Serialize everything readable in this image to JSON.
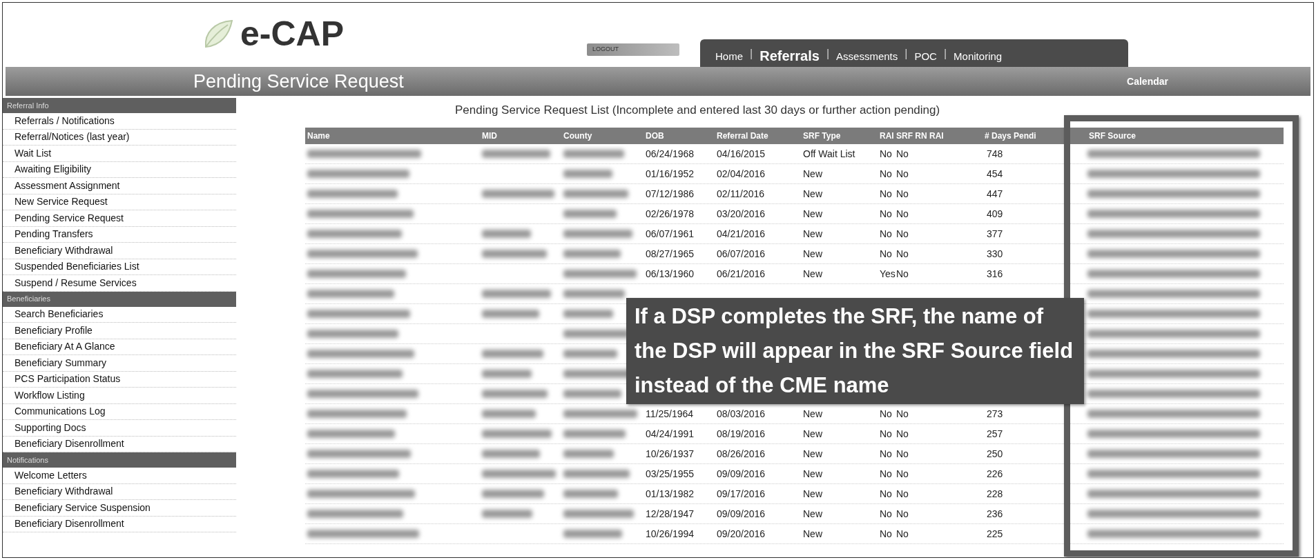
{
  "logo": {
    "text": "e-CAP"
  },
  "logout_button": "LOGOUT",
  "nav": {
    "separator": "|",
    "tabs": [
      {
        "label": "Home",
        "selected": false
      },
      {
        "label": "Referrals",
        "selected": true
      },
      {
        "label": "Assessments",
        "selected": false
      },
      {
        "label": "POC",
        "selected": false
      },
      {
        "label": "Monitoring",
        "selected": false
      }
    ]
  },
  "page_title": "Pending Service Request",
  "calendar_link": "Calendar",
  "sidebar": [
    {
      "heading": "Referral Info",
      "items": [
        "Referrals / Notifications",
        "Referral/Notices (last year)",
        "Wait List",
        "Awaiting Eligibility",
        "Assessment Assignment",
        "New Service Request",
        "Pending Service Request",
        "Pending Transfers",
        "Beneficiary Withdrawal",
        "Suspended Beneficiaries List",
        "Suspend / Resume Services"
      ]
    },
    {
      "heading": "Beneficiaries",
      "items": [
        "Search Beneficiaries",
        "Beneficiary Profile",
        "Beneficiary At A Glance",
        "Beneficiary Summary",
        "PCS Participation Status",
        "Workflow Listing",
        "Communications Log",
        "Supporting Docs",
        "Beneficiary Disenrollment"
      ]
    },
    {
      "heading": "Notifications",
      "items": [
        "Welcome Letters",
        "Beneficiary Withdrawal",
        "Beneficiary Service Suspension",
        "Beneficiary Disenrollment"
      ]
    }
  ],
  "list_title": "Pending Service Request List (Incomplete and entered last 30 days or further action pending)",
  "table": {
    "columns": [
      {
        "label": "Name",
        "highlighted": false
      },
      {
        "label": "MID",
        "highlighted": false
      },
      {
        "label": "County",
        "highlighted": false
      },
      {
        "label": "DOB",
        "highlighted": false
      },
      {
        "label": "Referral Date",
        "highlighted": false
      },
      {
        "label": "SRF Type",
        "highlighted": false
      },
      {
        "label": "RAI",
        "highlighted": false
      },
      {
        "label": "SRF RN RAI",
        "highlighted": false
      },
      {
        "label": "# Days Pendi",
        "highlighted": false
      },
      {
        "label": "SRF Source",
        "highlighted": true
      }
    ],
    "rows": [
      {
        "redacted": {
          "name": true,
          "mid": true,
          "county": true,
          "srf_source": true
        },
        "cells": [
          "06/24/1968",
          "04/16/2015",
          "Off Wait List",
          "No",
          "No",
          "748"
        ]
      },
      {
        "redacted": {
          "name": true,
          "mid": false,
          "county": true,
          "srf_source": true
        },
        "cells": [
          "01/16/1952",
          "02/04/2016",
          "New",
          "No",
          "No",
          "454"
        ]
      },
      {
        "redacted": {
          "name": true,
          "mid": true,
          "county": true,
          "srf_source": true
        },
        "cells": [
          "07/12/1986",
          "02/11/2016",
          "New",
          "No",
          "No",
          "447"
        ]
      },
      {
        "redacted": {
          "name": true,
          "mid": false,
          "county": true,
          "srf_source": true
        },
        "cells": [
          "02/26/1978",
          "03/20/2016",
          "New",
          "No",
          "No",
          "409"
        ]
      },
      {
        "redacted": {
          "name": true,
          "mid": true,
          "county": true,
          "srf_source": true
        },
        "cells": [
          "06/07/1961",
          "04/21/2016",
          "New",
          "No",
          "No",
          "377"
        ]
      },
      {
        "redacted": {
          "name": true,
          "mid": true,
          "county": true,
          "srf_source": true
        },
        "cells": [
          "08/27/1965",
          "06/07/2016",
          "New",
          "No",
          "No",
          "330"
        ]
      },
      {
        "redacted": {
          "name": true,
          "mid": false,
          "county": true,
          "srf_source": true
        },
        "cells": [
          "06/13/1960",
          "06/21/2016",
          "New",
          "Yes",
          "No",
          "316"
        ]
      },
      {
        "redacted": {
          "name": true,
          "mid": true,
          "county": true,
          "srf_source": true
        }
      },
      {
        "redacted": {
          "name": true,
          "mid": true,
          "county": true,
          "srf_source": true
        }
      },
      {
        "redacted": {
          "name": true,
          "mid": false,
          "county": true,
          "srf_source": true
        }
      },
      {
        "redacted": {
          "name": true,
          "mid": true,
          "county": true,
          "srf_source": true
        }
      },
      {
        "redacted": {
          "name": true,
          "mid": true,
          "county": true,
          "srf_source": true
        }
      },
      {
        "redacted": {
          "name": true,
          "mid": true,
          "county": true,
          "srf_source": true
        }
      },
      {
        "redacted": {
          "name": true,
          "mid": true,
          "county": true,
          "srf_source": true
        },
        "cells": [
          "11/25/1964",
          "08/03/2016",
          "New",
          "No",
          "No",
          "273"
        ]
      },
      {
        "redacted": {
          "name": true,
          "mid": true,
          "county": true,
          "srf_source": true
        },
        "cells": [
          "04/24/1991",
          "08/19/2016",
          "New",
          "No",
          "No",
          "257"
        ]
      },
      {
        "redacted": {
          "name": true,
          "mid": true,
          "county": true,
          "srf_source": true
        },
        "cells": [
          "10/26/1937",
          "08/26/2016",
          "New",
          "No",
          "No",
          "250"
        ]
      },
      {
        "redacted": {
          "name": true,
          "mid": true,
          "county": true,
          "srf_source": true
        },
        "cells": [
          "03/25/1955",
          "09/09/2016",
          "New",
          "No",
          "No",
          "226"
        ]
      },
      {
        "redacted": {
          "name": true,
          "mid": true,
          "county": true,
          "srf_source": true
        },
        "cells": [
          "01/13/1982",
          "09/17/2016",
          "New",
          "No",
          "No",
          "228"
        ]
      },
      {
        "redacted": {
          "name": true,
          "mid": true,
          "county": true,
          "srf_source": true
        },
        "cells": [
          "12/28/1947",
          "09/09/2016",
          "New",
          "No",
          "No",
          "236"
        ]
      },
      {
        "redacted": {
          "name": true,
          "mid": false,
          "county": true,
          "srf_source": true
        },
        "cells": [
          "10/26/1994",
          "09/20/2016",
          "New",
          "No",
          "No",
          "225"
        ]
      }
    ]
  },
  "callout": {
    "text": "If a DSP completes the SRF, the name of the DSP will appear in the SRF Source field instead of the CME name"
  }
}
